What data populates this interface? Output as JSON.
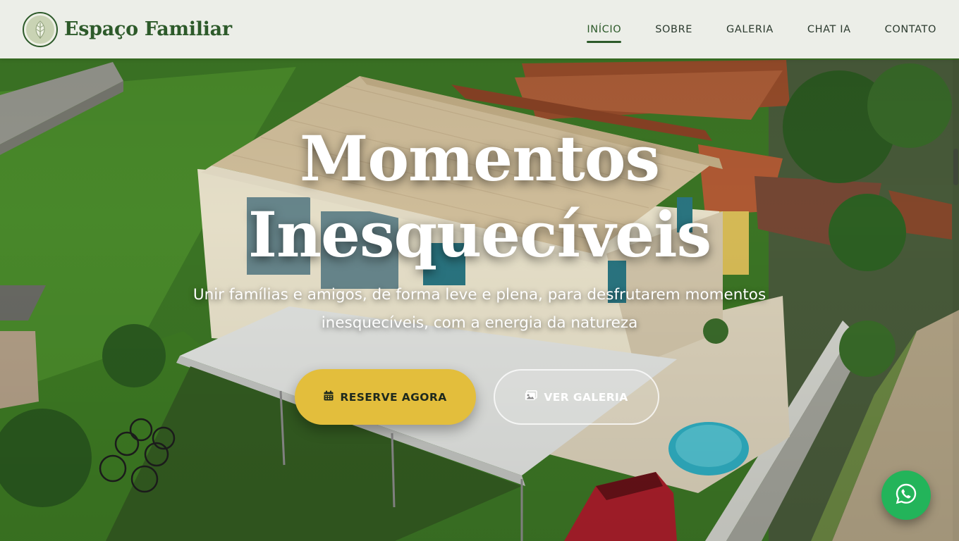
{
  "brand": {
    "name": "Espaço Familiar",
    "logo_icon": "leaf-icon"
  },
  "nav": {
    "items": [
      {
        "label": "INÍCIO",
        "active": true
      },
      {
        "label": "SOBRE",
        "active": false
      },
      {
        "label": "GALERIA",
        "active": false
      },
      {
        "label": "CHAT IA",
        "active": false
      },
      {
        "label": "CONTATO",
        "active": false
      }
    ]
  },
  "hero": {
    "title_line1": "Momentos",
    "title_line2": "Inesquecíveis",
    "subtitle": "Unir famílias e amigos, de forma leve e plena, para desfrutarem momentos inesquecíveis, com a energia da natureza",
    "background": "aerial-photo-of-house-with-garden",
    "buttons": {
      "reserve": {
        "label": "RESERVE AGORA",
        "icon": "calendar-icon"
      },
      "gallery": {
        "label": "VER GALERIA",
        "icon": "image-icon"
      }
    }
  },
  "floating": {
    "whatsapp_icon": "whatsapp-icon"
  },
  "colors": {
    "brand_green": "#2d5a2a",
    "accent_yellow": "#e3be3c",
    "whatsapp_green": "#23b45a",
    "header_bg": "#f4f4f0"
  }
}
